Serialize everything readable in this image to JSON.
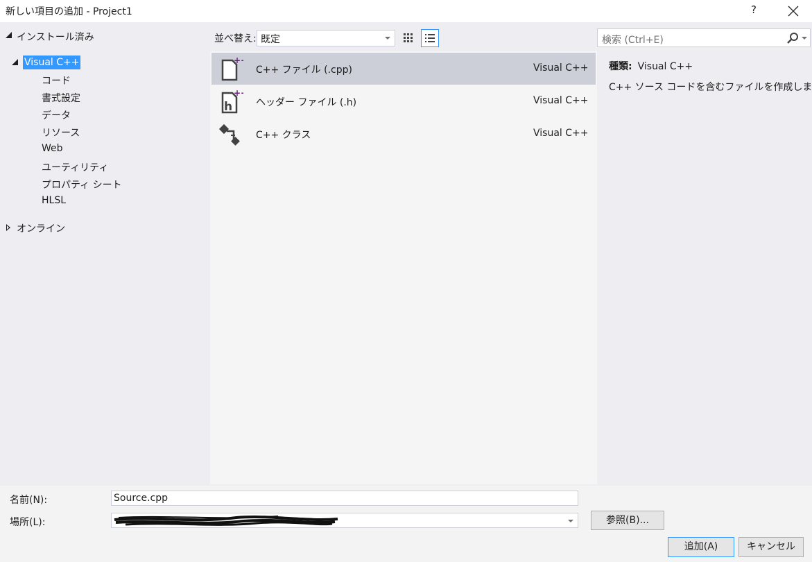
{
  "window": {
    "title": "新しい項目の追加 - Project1",
    "help_label": "?"
  },
  "tree": {
    "installed": "インストール済み",
    "visual_cpp": "Visual C++",
    "children": [
      "コード",
      "書式設定",
      "データ",
      "リソース",
      "Web",
      "ユーティリティ",
      "プロパティ シート",
      "HLSL"
    ],
    "online": "オンライン"
  },
  "toolbar": {
    "sort_label": "並べ替え:",
    "sort_value": "既定"
  },
  "templates": [
    {
      "name": "C++ ファイル (.cpp)",
      "language": "Visual C++",
      "icon": "cpp-file-icon",
      "selected": true
    },
    {
      "name": "ヘッダー ファイル (.h)",
      "language": "Visual C++",
      "icon": "header-file-icon",
      "selected": false
    },
    {
      "name": "C++ クラス",
      "language": "Visual C++",
      "icon": "cpp-class-icon",
      "selected": false
    }
  ],
  "search": {
    "placeholder": "検索 (Ctrl+E)"
  },
  "details": {
    "type_label": "種類:",
    "type_value": "Visual C++",
    "description": "C++ ソース コードを含むファイルを作成します"
  },
  "form": {
    "name_label": "名前(N):",
    "name_value": "Source.cpp",
    "location_label": "場所(L):",
    "location_value": "",
    "browse_label": "参照(B)...",
    "add_label": "追加(A)",
    "cancel_label": "キャンセル"
  },
  "colors": {
    "selection_blue": "#3399ff",
    "selected_row": "#ccced8",
    "dialog_bg": "#eeeef2",
    "accent_purple": "#68217a"
  }
}
